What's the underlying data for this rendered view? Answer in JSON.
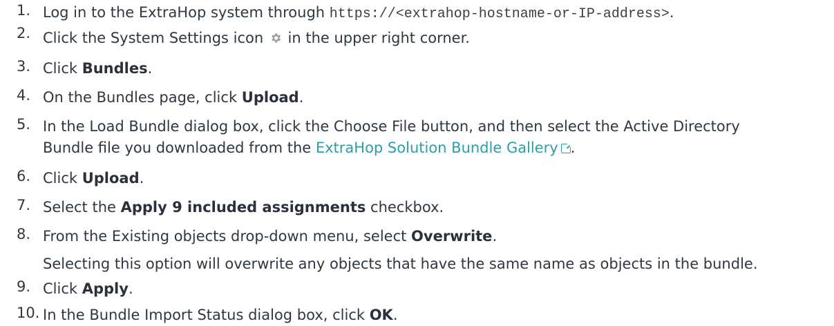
{
  "steps": [
    {
      "num": "1.",
      "pre": "Log in to the ExtraHop system through ",
      "code": "https://<extrahop-hostname-or-IP-address>",
      "post": "."
    },
    {
      "num": "2.",
      "pre": "Click the System Settings icon ",
      "post": " in the upper right corner.",
      "icon": "gear-icon"
    },
    {
      "num": "3.",
      "pre": "Click ",
      "bold": "Bundles",
      "post": "."
    },
    {
      "num": "4.",
      "pre": "On the Bundles page, click ",
      "bold": "Upload",
      "post": "."
    },
    {
      "num": "5.",
      "line1": "In the Load Bundle dialog box, click the Choose File button, and then select the Active Directory",
      "line2_pre": "Bundle file you downloaded from the ",
      "link": "ExtraHop Solution Bundle Gallery",
      "post": ".",
      "link_icon": "external-link-icon"
    },
    {
      "num": "6.",
      "pre": "Click ",
      "bold": "Upload",
      "post": "."
    },
    {
      "num": "7.",
      "pre": "Select the ",
      "bold": "Apply 9 included assignments",
      "post": " checkbox."
    },
    {
      "num": "8.",
      "pre": "From the Existing objects drop-down menu, select ",
      "bold": "Overwrite",
      "post": ".",
      "note": "Selecting this option will overwrite any objects that have the same name as objects in the bundle."
    },
    {
      "num": "9.",
      "pre": "Click ",
      "bold": "Apply",
      "post": "."
    },
    {
      "num": "10.",
      "pre": "In the Bundle Import Status dialog box, click ",
      "bold": "OK",
      "post": "."
    }
  ],
  "colors": {
    "text": "#2f3742",
    "link": "#2c9ea6",
    "icon": "#9aa1a8"
  }
}
